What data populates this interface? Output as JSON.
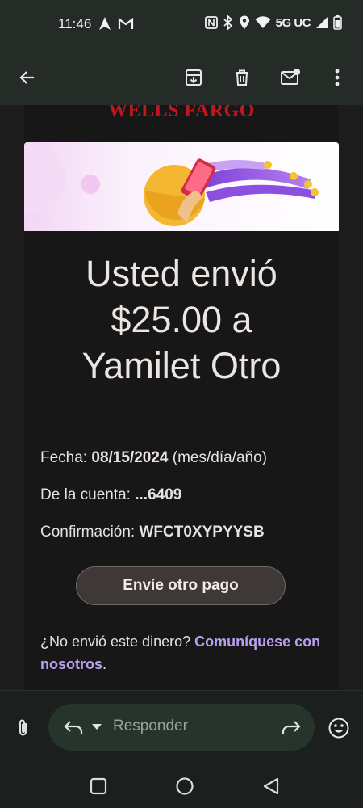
{
  "status_bar": {
    "time": "11:46",
    "network": "5G UC"
  },
  "app_bar": {
    "icons": [
      "back-arrow-icon",
      "archive-icon",
      "delete-icon",
      "mark-unread-icon",
      "more-vert-icon"
    ]
  },
  "email": {
    "brand": "WELLS FARGO",
    "headline_line1": "Usted envió",
    "headline_line2": "$25.00 a",
    "headline_line3": "Yamilet Otro",
    "details": {
      "date_label": "Fecha:",
      "date_value": "08/15/2024",
      "date_format": "(mes/día/año)",
      "account_label": "De la cuenta:",
      "account_value": "...6409",
      "confirmation_label": "Confirmación:",
      "confirmation_value": "WFCT0XYPYYSB"
    },
    "cta_label": "Envíe otro pago",
    "not_sent_text": "¿No envió este dinero?",
    "contact_link": "Comuníquese con nosotros",
    "period": "."
  },
  "reply_bar": {
    "placeholder": "Responder"
  },
  "colors": {
    "brand_red": "#c0161c",
    "link_purple": "#b8a0f0",
    "header_bg": "#252b27"
  }
}
